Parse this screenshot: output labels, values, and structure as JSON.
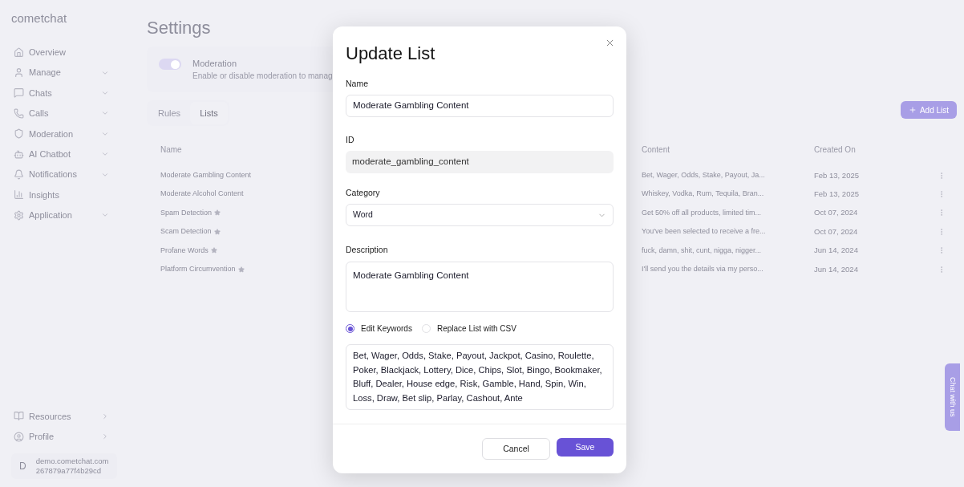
{
  "sidebar": {
    "logo": "cometchat",
    "nav_items": [
      {
        "label": "Overview",
        "expandable": false
      },
      {
        "label": "Manage",
        "expandable": true
      },
      {
        "label": "Chats",
        "expandable": true
      },
      {
        "label": "Calls",
        "expandable": true
      },
      {
        "label": "Moderation",
        "expandable": true
      },
      {
        "label": "AI Chatbot",
        "expandable": true
      },
      {
        "label": "Notifications",
        "expandable": true
      },
      {
        "label": "Insights",
        "expandable": false
      },
      {
        "label": "Application",
        "expandable": true
      }
    ],
    "bottom_items": [
      {
        "label": "Resources"
      },
      {
        "label": "Profile"
      }
    ],
    "account": {
      "avatar_letter": "D",
      "domain": "demo.cometchat.com",
      "app_id": "267879a77f4b29cd"
    }
  },
  "main": {
    "title": "Settings",
    "moderation": {
      "on": true,
      "label": "Moderation",
      "description": "Enable or disable moderation to manag"
    },
    "tabs": [
      {
        "label": "Rules",
        "selected": false
      },
      {
        "label": "Lists",
        "selected": true
      }
    ],
    "add_button": "Add List",
    "table": {
      "columns": [
        "Name",
        "Content",
        "Created On"
      ],
      "rows": [
        {
          "name": "Moderate Gambling Content",
          "starred": false,
          "content": "Bet, Wager, Odds, Stake, Payout, Ja...",
          "created": "Feb 13, 2025"
        },
        {
          "name": "Moderate Alcohol Content",
          "starred": false,
          "content": "Whiskey, Vodka, Rum, Tequila, Bran...",
          "created": "Feb 13, 2025"
        },
        {
          "name": "Spam Detection",
          "starred": true,
          "content": "Get 50% off all products, limited tim...",
          "created": "Oct 07, 2024"
        },
        {
          "name": "Scam Detection",
          "starred": true,
          "content": "You've been selected to receive a fre...",
          "created": "Oct 07, 2024"
        },
        {
          "name": "Profane Words",
          "starred": true,
          "content": "fuck, damn, shit, cunt, nigga, nigger...",
          "created": "Jun 14, 2024"
        },
        {
          "name": "Platform Circumvention",
          "starred": true,
          "content": "I'll send you the details via my perso...",
          "created": "Jun 14, 2024"
        }
      ]
    }
  },
  "chat_tab": "Chat with us",
  "dialog": {
    "title": "Update List",
    "name": {
      "label": "Name",
      "value": "Moderate Gambling Content"
    },
    "id": {
      "label": "ID",
      "value": "moderate_gambling_content",
      "disabled": true
    },
    "category": {
      "label": "Category",
      "value": "Word"
    },
    "description": {
      "label": "Description",
      "value": "Moderate Gambling Content"
    },
    "modes": [
      {
        "label": "Edit Keywords",
        "selected": true
      },
      {
        "label": "Replace List with CSV",
        "selected": false
      }
    ],
    "keywords": "Bet, Wager, Odds, Stake, Payout, Jackpot, Casino, Roulette, Poker, Blackjack, Lottery, Dice, Chips, Slot, Bingo, Bookmaker, Bluff, Dealer, House edge, Risk, Gamble, Hand, Spin, Win, Loss, Draw, Bet slip, Parlay, Cashout, Ante",
    "buttons": {
      "cancel": "Cancel",
      "save": "Save"
    }
  }
}
